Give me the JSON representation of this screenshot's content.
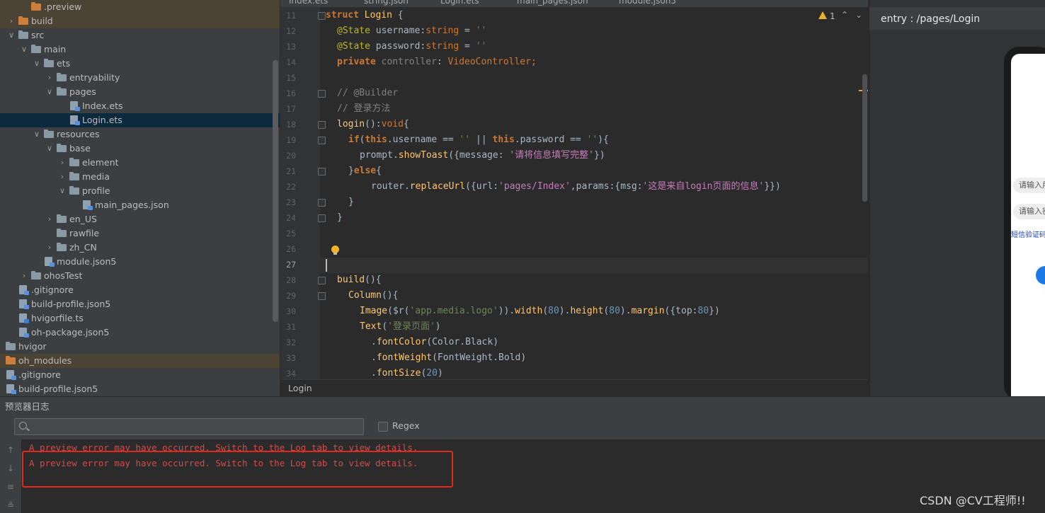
{
  "project_tree": {
    "items": [
      {
        "label": ".preview",
        "folder": "orange"
      },
      {
        "label": "build",
        "folder": "orange"
      },
      {
        "label": "src",
        "folder": "grey"
      },
      {
        "label": "main",
        "folder": "grey"
      },
      {
        "label": "ets",
        "folder": "grey"
      },
      {
        "label": "entryability",
        "folder": "grey"
      },
      {
        "label": "pages",
        "folder": "grey"
      },
      {
        "label": "Index.ets",
        "file": true
      },
      {
        "label": "Login.ets",
        "file": true
      },
      {
        "label": "resources",
        "folder": "grey"
      },
      {
        "label": "base",
        "folder": "grey"
      },
      {
        "label": "element",
        "folder": "grey"
      },
      {
        "label": "media",
        "folder": "grey"
      },
      {
        "label": "profile",
        "folder": "grey"
      },
      {
        "label": "main_pages.json",
        "file": true
      },
      {
        "label": "en_US",
        "folder": "grey"
      },
      {
        "label": "rawfile",
        "folder": "grey"
      },
      {
        "label": "zh_CN",
        "folder": "grey"
      },
      {
        "label": "module.json5",
        "file": true
      },
      {
        "label": "ohosTest",
        "folder": "grey"
      },
      {
        "label": ".gitignore",
        "file": true
      },
      {
        "label": "build-profile.json5",
        "file": true
      },
      {
        "label": "hvigorfile.ts",
        "file": true
      },
      {
        "label": "oh-package.json5",
        "file": true
      },
      {
        "label": "hvigor",
        "folder": "grey"
      },
      {
        "label": "oh_modules",
        "folder": "orange"
      },
      {
        "label": ".gitignore",
        "file": true
      },
      {
        "label": "build-profile.json5",
        "file": true
      }
    ]
  },
  "editor": {
    "tabs": [
      "Index.ets",
      "string.json",
      "Login.ets",
      "main_pages.json",
      "module.json5"
    ],
    "line_numbers": [
      "11",
      "12",
      "13",
      "14",
      "15",
      "16",
      "17",
      "18",
      "19",
      "20",
      "21",
      "22",
      "23",
      "24",
      "25",
      "26",
      "27",
      "28",
      "29",
      "30",
      "31",
      "32",
      "33",
      "34"
    ],
    "warning_count": "1",
    "breadcrumb": "Login",
    "code": {
      "l11_struct": "struct",
      "l11_name": "Login",
      "l11_brace": " {",
      "l12_ann": "@State",
      "l12_rest": " username:",
      "l12_type": "string",
      "l12_eq": " = ",
      "l12_val": "''",
      "l13_ann": "@State",
      "l13_rest": " password:",
      "l13_type": "string",
      "l13_eq": " = ",
      "l13_val": "''",
      "l14_kw": "private",
      "l14_field": " controller",
      "l14_colon": ": ",
      "l14_type": "VideoController",
      "l14_end": ";",
      "l16": "// @Builder",
      "l17": "// 登录方法",
      "l18_fn": "login",
      "l18_mid": "():",
      "l18_type": "void",
      "l18_end": "{",
      "l19_if": "if",
      "l19_p1": "(",
      "l19_this1": "this",
      "l19_a": ".username == ",
      "l19_s1": "''",
      "l19_or": " || ",
      "l19_this2": "this",
      "l19_b": ".password == ",
      "l19_s2": "''",
      "l19_end": "){",
      "l20_obj": "prompt.",
      "l20_fn": "showToast",
      "l20_a": "({message: ",
      "l20_str": "'请将信息填写完整'",
      "l20_end": "})",
      "l21_a": "}",
      "l21_else": "else",
      "l21_b": "{",
      "l22_obj": "router.",
      "l22_fn": "replaceUrl",
      "l22_a": "({url:",
      "l22_s1": "'pages/Index'",
      "l22_b": ",params:{msg:",
      "l22_s2": "'这是来自login页面的信息'",
      "l22_end": "}})",
      "l23": "}",
      "l24": "}",
      "l28_fn": "build",
      "l28_end": "(){",
      "l29_fn": "Column",
      "l29_end": "(){",
      "l30_fn": "Image",
      "l30_a": "($r(",
      "l30_s": "'app.media.logo'",
      "l30_b": ")).",
      "l30_w": "width",
      "l30_c": "(",
      "l30_n1": "80",
      "l30_d": ").",
      "l30_h": "height",
      "l30_e": "(",
      "l30_n2": "80",
      "l30_f": ").",
      "l30_m": "margin",
      "l30_g": "({top:",
      "l30_n3": "80",
      "l30_end": "})",
      "l31_fn": "Text",
      "l31_a": "(",
      "l31_s": "'登录页面'",
      "l31_end": ")",
      "l32_dot": ".",
      "l32_fn": "fontColor",
      "l32_arg": "(Color.Black)",
      "l33_dot": ".",
      "l33_fn": "fontWeight",
      "l33_arg": "(FontWeight.Bold)",
      "l34_dot": ".",
      "l34_fn": "fontSize",
      "l34_a": "(",
      "l34_n": "20",
      "l34_end": ")"
    }
  },
  "preview": {
    "header": "entry : /pages/Login",
    "input_username_placeholder": "请输入用户名",
    "input_password_placeholder": "请输入密码",
    "sms_link": "短信验证码"
  },
  "log_panel": {
    "title": "预览器日志",
    "search_placeholder": "",
    "regex_label": "Regex",
    "lines": [
      "A preview error may have occurred. Switch to the Log tab to view details.",
      "A preview error may have occurred. Switch to the Log tab to view details."
    ]
  },
  "watermark": "CSDN @CV工程师!!",
  "colors": {
    "accent": "#4a88c7",
    "error_text": "#d14b4b",
    "highlight_box": "#e0281b"
  }
}
